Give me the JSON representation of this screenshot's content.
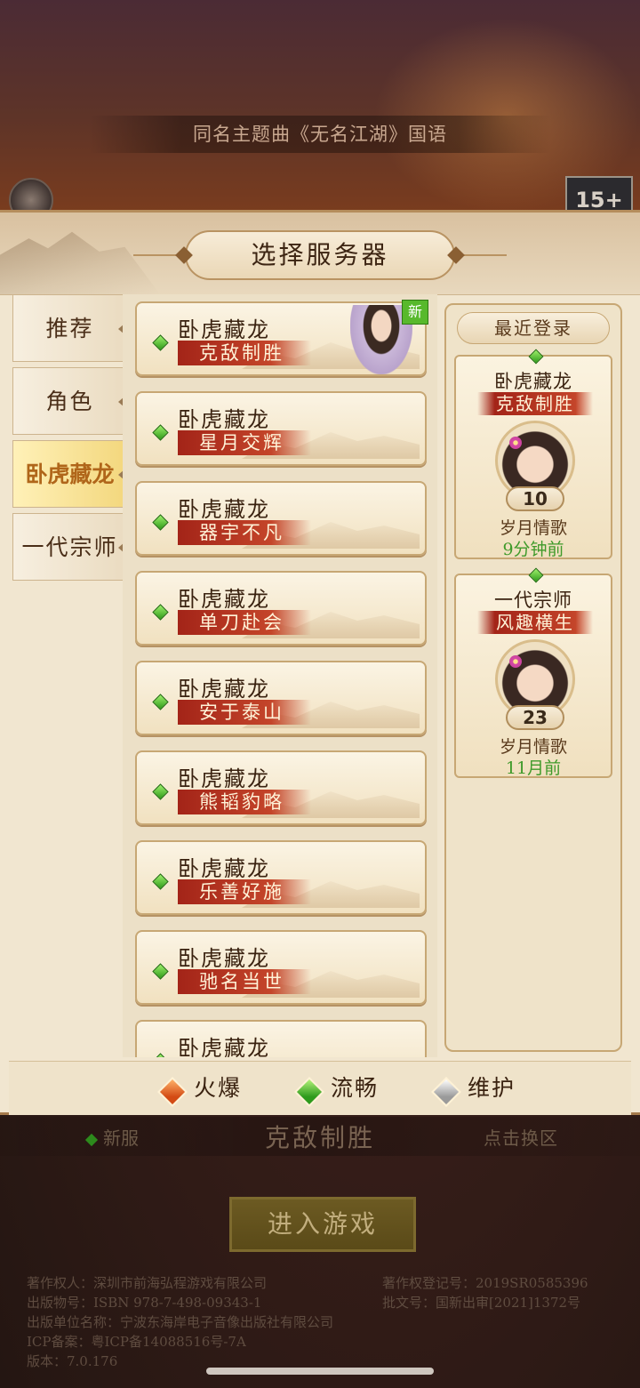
{
  "background": {
    "theme_song": "同名主题曲《无名江湖》国语",
    "age_rating": "15+"
  },
  "dialog": {
    "title": "选择服务器"
  },
  "sidebar": {
    "items": [
      {
        "label": "推荐",
        "active": false
      },
      {
        "label": "角色",
        "active": false
      },
      {
        "label": "卧虎藏龙",
        "active": true
      },
      {
        "label": "一代宗师",
        "active": false
      }
    ]
  },
  "server_list": [
    {
      "name": "卧虎藏龙",
      "sub": "克敌制胜",
      "status": "smooth",
      "new_tag": "新"
    },
    {
      "name": "卧虎藏龙",
      "sub": "星月交辉",
      "status": "smooth"
    },
    {
      "name": "卧虎藏龙",
      "sub": "器宇不凡",
      "status": "smooth"
    },
    {
      "name": "卧虎藏龙",
      "sub": "单刀赴会",
      "status": "smooth"
    },
    {
      "name": "卧虎藏龙",
      "sub": "安于泰山",
      "status": "smooth"
    },
    {
      "name": "卧虎藏龙",
      "sub": "熊韬豹略",
      "status": "smooth"
    },
    {
      "name": "卧虎藏龙",
      "sub": "乐善好施",
      "status": "smooth"
    },
    {
      "name": "卧虎藏龙",
      "sub": "驰名当世",
      "status": "smooth"
    },
    {
      "name": "卧虎藏龙",
      "sub": "",
      "status": "smooth"
    }
  ],
  "recent": {
    "title": "最近登录",
    "items": [
      {
        "name": "卧虎藏龙",
        "sub": "克敌制胜",
        "level": "10",
        "role": "岁月情歌",
        "time": "9分钟前"
      },
      {
        "name": "一代宗师",
        "sub": "风趣横生",
        "level": "23",
        "role": "岁月情歌",
        "time": "11月前"
      }
    ]
  },
  "legend": {
    "hot": "火爆",
    "smooth": "流畅",
    "maintenance": "维护"
  },
  "bottom": {
    "new_server_label": "新服",
    "current_server": "克敌制胜",
    "switch_label": "点击换区",
    "enter_button": "进入游戏"
  },
  "copyright": {
    "line1_left": "著作权人：深圳市前海弘程游戏有限公司",
    "line1_right": "著作权登记号：2019SR0585396",
    "line2_left": "出版物号：ISBN 978-7-498-09343-1",
    "line2_right": "批文号：国新出审[2021]1372号",
    "line3": "出版单位名称：宁波东海岸电子音像出版社有限公司",
    "line4": "ICP备案：粤ICP备14088516号-7A",
    "version": "版本：7.0.176"
  },
  "colors": {
    "active_tab": "#f3d77d",
    "sub_banner": "#a32418",
    "status_smooth": "#2f9a1b",
    "status_hot": "#d34b14",
    "time_text": "#3f9a2a"
  }
}
